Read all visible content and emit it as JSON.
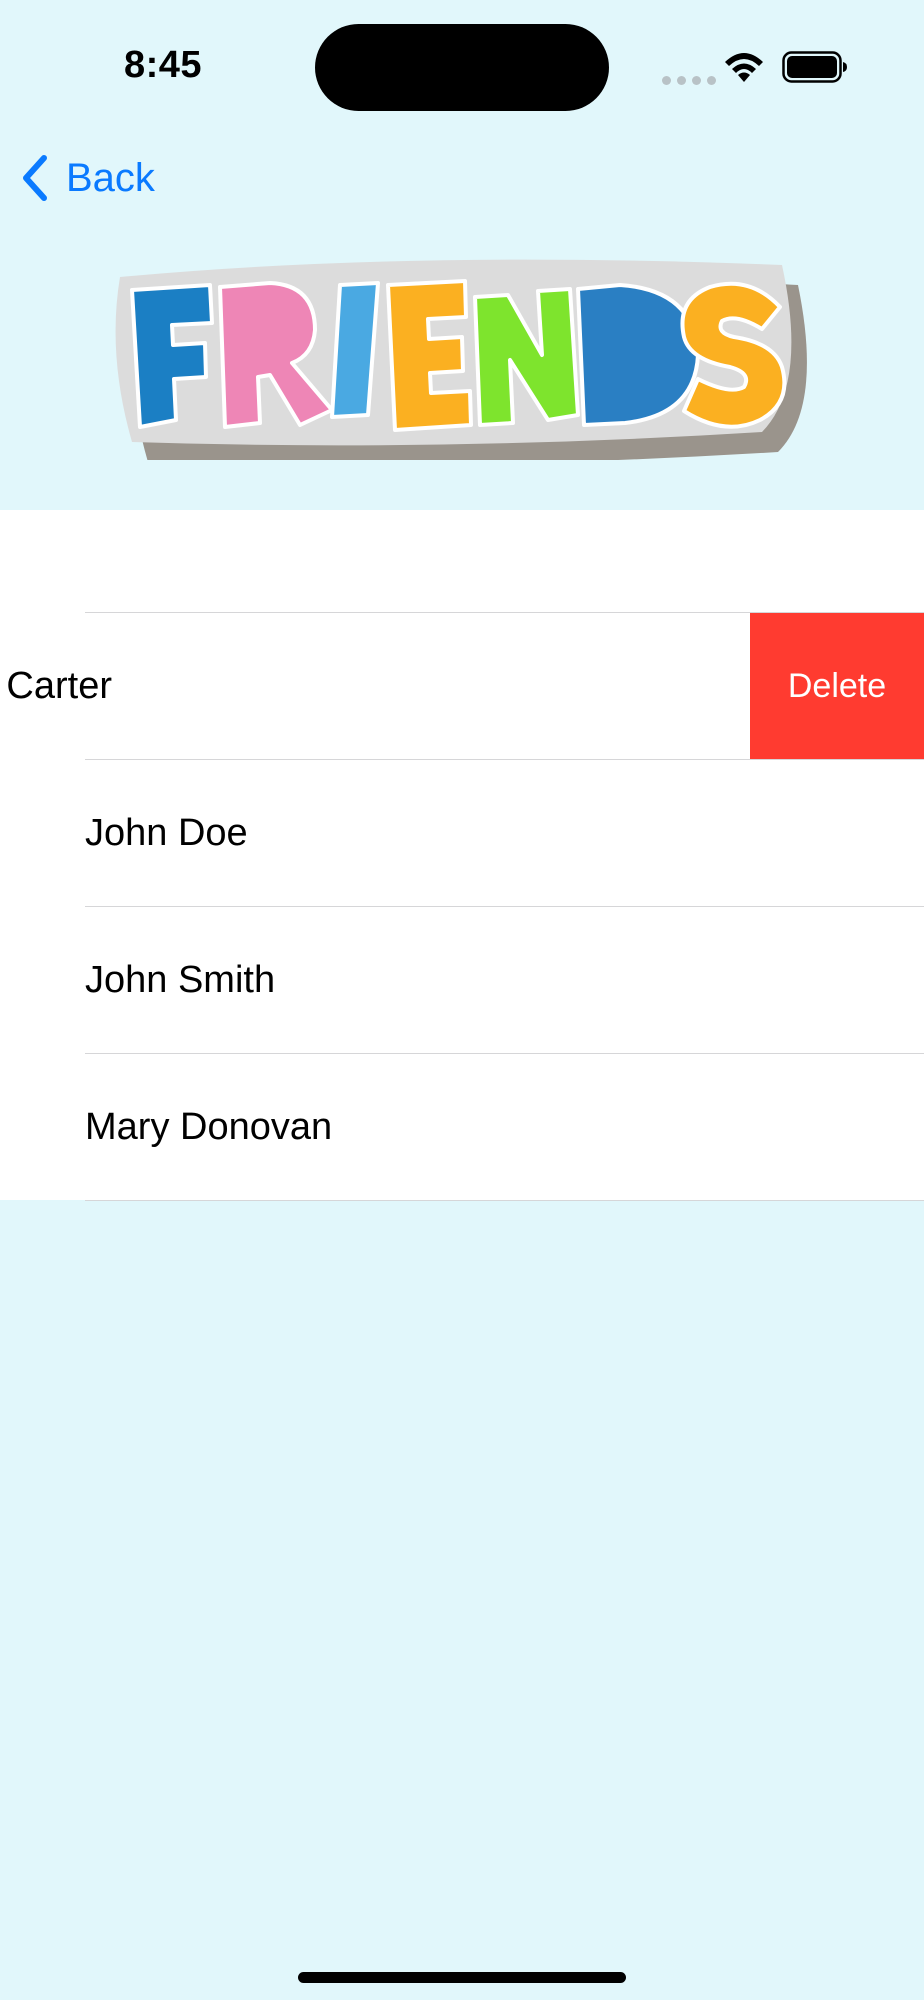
{
  "status_bar": {
    "time": "8:45"
  },
  "nav": {
    "back_label": "Back"
  },
  "header": {
    "logo_text": "FRIENDS",
    "logo_colors": [
      "#1b7fc4",
      "#ee86b6",
      "#4aa9e2",
      "#fbb021",
      "#7ee42d",
      "#2a7fc3",
      "#fbb021"
    ]
  },
  "friends": [
    {
      "name": "Carter",
      "swiped": true,
      "action_label": "Delete"
    },
    {
      "name": "John Doe"
    },
    {
      "name": "John Smith"
    },
    {
      "name": "Mary Donovan"
    }
  ],
  "colors": {
    "background": "#e1f7fb",
    "accent": "#0a7aff",
    "destructive": "#ff3b30"
  }
}
